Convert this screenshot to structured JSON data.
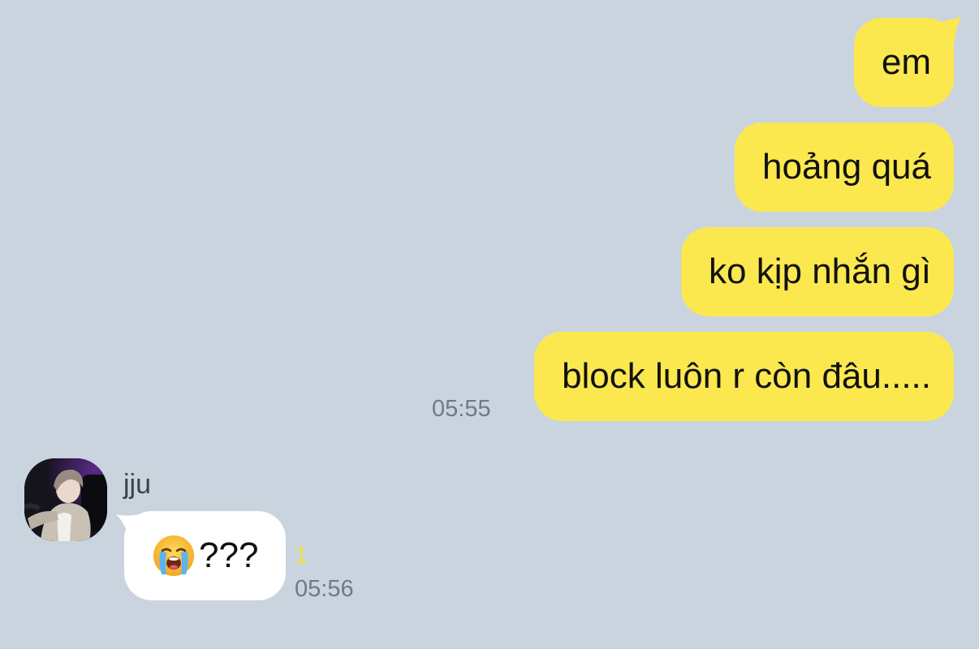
{
  "colors": {
    "background": "#cad4de",
    "outgoing_bubble": "#fbe84f",
    "incoming_bubble": "#ffffff",
    "unread_count": "#f6df3b",
    "timestamp": "#6f7a86"
  },
  "outgoing": {
    "messages": [
      {
        "text": "em"
      },
      {
        "text": "hoảng quá"
      },
      {
        "text": "ko kịp nhắn gì"
      },
      {
        "text": "block luôn r còn đâu....."
      }
    ],
    "timestamp": "05:55"
  },
  "incoming": {
    "sender_name": "jju",
    "avatar_icon": "profile-photo",
    "emoji_icon": "loudly-crying-face-emoji",
    "message_text": "???",
    "unread_count": "1",
    "timestamp": "05:56"
  }
}
